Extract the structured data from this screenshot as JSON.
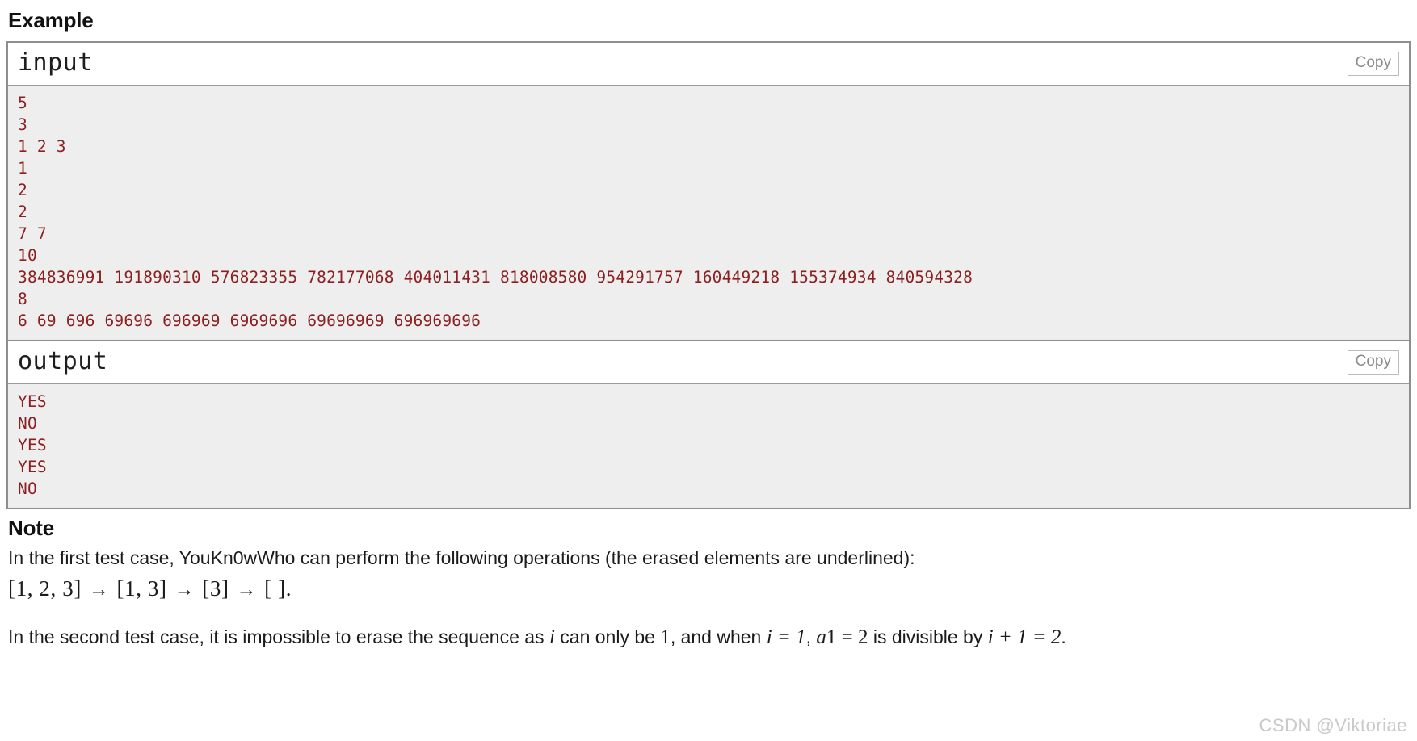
{
  "colors": {
    "io_text": "#8c1f1f",
    "io_background": "#eeeeee",
    "border": "#8e8e8e",
    "copy_button_text": "#8a8a8a",
    "watermark": "#c9c9c9",
    "body_text": "#1b1b1b"
  },
  "example": {
    "heading": "Example",
    "samples": [
      {
        "title": "input",
        "copy_label": "Copy",
        "content": "5\n3\n1 2 3\n1\n2\n2\n7 7\n10\n384836991 191890310 576823355 782177068 404011431 818008580 954291757 160449218 155374934 840594328\n8\n6 69 696 69696 696969 6969696 69696969 696969696"
      },
      {
        "title": "output",
        "copy_label": "Copy",
        "content": "YES\nNO\nYES\nYES\nNO"
      }
    ]
  },
  "note": {
    "heading": "Note",
    "paragraph_1": "In the first test case, YouKn0wWho can perform the following operations (the erased elements are underlined):",
    "sequence_steps": [
      {
        "prefix": "[1, ",
        "erased": "2",
        "suffix": ", 3]"
      },
      {
        "prefix": "[",
        "erased": "1",
        "suffix": ", 3]"
      },
      {
        "prefix": "[",
        "erased": "3",
        "suffix": "]"
      },
      {
        "prefix": "[ ]",
        "erased": "",
        "suffix": ""
      }
    ],
    "arrow": "→",
    "sequence_terminator": ".",
    "paragraph_2": {
      "part_1": "In the second test case, it is impossible to erase the sequence as ",
      "var_i": "i",
      "part_2": " can only be ",
      "num_1": "1",
      "part_3": ", and when ",
      "eq_i": "i = 1",
      "part_4": ", ",
      "var_a": "a",
      "sub_1": "1",
      "eq_a": " = 2",
      "part_5": " is divisible by ",
      "eq_tail": "i + 1 = 2",
      "period": "."
    }
  },
  "watermark": "CSDN @Viktoriae"
}
